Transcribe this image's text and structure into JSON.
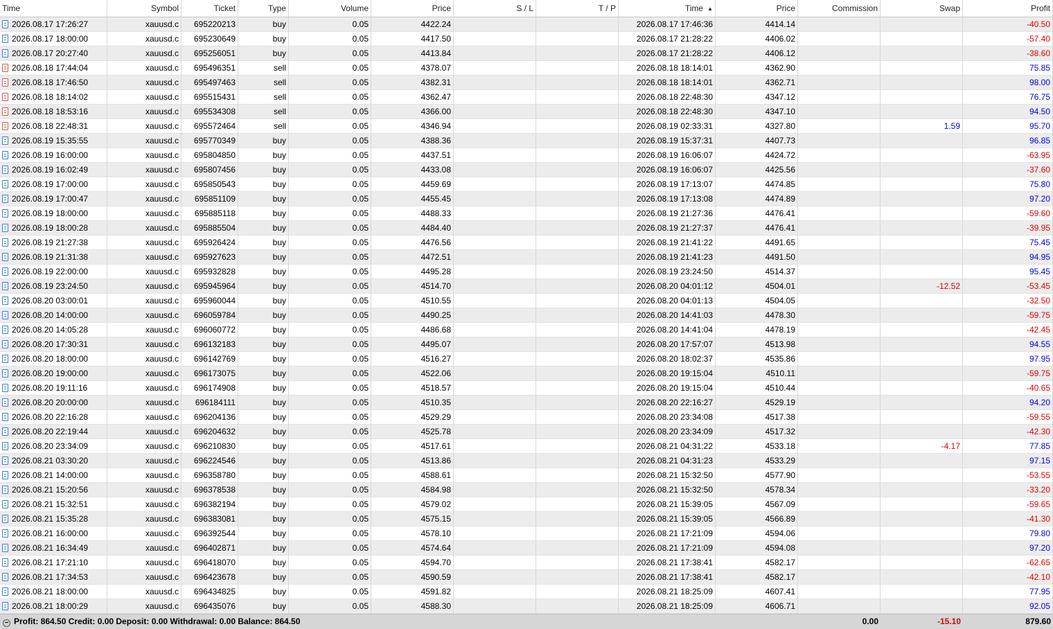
{
  "columns": [
    {
      "key": "open_time",
      "label": "Time",
      "align": "l"
    },
    {
      "key": "symbol",
      "label": "Symbol",
      "align": "r"
    },
    {
      "key": "ticket",
      "label": "Ticket",
      "align": "r"
    },
    {
      "key": "type",
      "label": "Type",
      "align": "r"
    },
    {
      "key": "volume",
      "label": "Volume",
      "align": "r"
    },
    {
      "key": "open_price",
      "label": "Price",
      "align": "r"
    },
    {
      "key": "sl",
      "label": "S / L",
      "align": "r"
    },
    {
      "key": "tp",
      "label": "T / P",
      "align": "r"
    },
    {
      "key": "close_time",
      "label": "Time",
      "align": "r",
      "sort": "▲"
    },
    {
      "key": "close_price",
      "label": "Price",
      "align": "r"
    },
    {
      "key": "commission",
      "label": "Commission",
      "align": "r"
    },
    {
      "key": "swap",
      "label": "Swap",
      "align": "r"
    },
    {
      "key": "profit",
      "label": "Profit",
      "align": "r"
    }
  ],
  "rows": [
    {
      "open_time": "2026.08.17 17:26:27",
      "symbol": "xauusd.c",
      "ticket": "695220213",
      "type": "buy",
      "volume": "0.05",
      "open_price": "4422.24",
      "sl": "",
      "tp": "",
      "close_time": "2026.08.17 17:46:36",
      "close_price": "4414.14",
      "commission": "",
      "swap": "",
      "profit": "-40.50"
    },
    {
      "open_time": "2026.08.17 18:00:00",
      "symbol": "xauusd.c",
      "ticket": "695230649",
      "type": "buy",
      "volume": "0.05",
      "open_price": "4417.50",
      "sl": "",
      "tp": "",
      "close_time": "2026.08.17 21:28:22",
      "close_price": "4406.02",
      "commission": "",
      "swap": "",
      "profit": "-57.40"
    },
    {
      "open_time": "2026.08.17 20:27:40",
      "symbol": "xauusd.c",
      "ticket": "695256051",
      "type": "buy",
      "volume": "0.05",
      "open_price": "4413.84",
      "sl": "",
      "tp": "",
      "close_time": "2026.08.17 21:28:22",
      "close_price": "4406.12",
      "commission": "",
      "swap": "",
      "profit": "-38.60"
    },
    {
      "open_time": "2026.08.18 17:44:04",
      "symbol": "xauusd.c",
      "ticket": "695496351",
      "type": "sell",
      "volume": "0.05",
      "open_price": "4378.07",
      "sl": "",
      "tp": "",
      "close_time": "2026.08.18 18:14:01",
      "close_price": "4362.90",
      "commission": "",
      "swap": "",
      "profit": "75.85"
    },
    {
      "open_time": "2026.08.18 17:46:50",
      "symbol": "xauusd.c",
      "ticket": "695497463",
      "type": "sell",
      "volume": "0.05",
      "open_price": "4382.31",
      "sl": "",
      "tp": "",
      "close_time": "2026.08.18 18:14:01",
      "close_price": "4362.71",
      "commission": "",
      "swap": "",
      "profit": "98.00"
    },
    {
      "open_time": "2026.08.18 18:14:02",
      "symbol": "xauusd.c",
      "ticket": "695515431",
      "type": "sell",
      "volume": "0.05",
      "open_price": "4362.47",
      "sl": "",
      "tp": "",
      "close_time": "2026.08.18 22:48:30",
      "close_price": "4347.12",
      "commission": "",
      "swap": "",
      "profit": "76.75"
    },
    {
      "open_time": "2026.08.18 18:53:16",
      "symbol": "xauusd.c",
      "ticket": "695534308",
      "type": "sell",
      "volume": "0.05",
      "open_price": "4366.00",
      "sl": "",
      "tp": "",
      "close_time": "2026.08.18 22:48:30",
      "close_price": "4347.10",
      "commission": "",
      "swap": "",
      "profit": "94.50"
    },
    {
      "open_time": "2026.08.18 22:48:31",
      "symbol": "xauusd.c",
      "ticket": "695572464",
      "type": "sell",
      "volume": "0.05",
      "open_price": "4346.94",
      "sl": "",
      "tp": "",
      "close_time": "2026.08.19 02:33:31",
      "close_price": "4327.80",
      "commission": "",
      "swap": "1.59",
      "profit": "95.70"
    },
    {
      "open_time": "2026.08.19 15:35:55",
      "symbol": "xauusd.c",
      "ticket": "695770349",
      "type": "buy",
      "volume": "0.05",
      "open_price": "4388.36",
      "sl": "",
      "tp": "",
      "close_time": "2026.08.19 15:37:31",
      "close_price": "4407.73",
      "commission": "",
      "swap": "",
      "profit": "96.85"
    },
    {
      "open_time": "2026.08.19 16:00:00",
      "symbol": "xauusd.c",
      "ticket": "695804850",
      "type": "buy",
      "volume": "0.05",
      "open_price": "4437.51",
      "sl": "",
      "tp": "",
      "close_time": "2026.08.19 16:06:07",
      "close_price": "4424.72",
      "commission": "",
      "swap": "",
      "profit": "-63.95"
    },
    {
      "open_time": "2026.08.19 16:02:49",
      "symbol": "xauusd.c",
      "ticket": "695807456",
      "type": "buy",
      "volume": "0.05",
      "open_price": "4433.08",
      "sl": "",
      "tp": "",
      "close_time": "2026.08.19 16:06:07",
      "close_price": "4425.56",
      "commission": "",
      "swap": "",
      "profit": "-37.60"
    },
    {
      "open_time": "2026.08.19 17:00:00",
      "symbol": "xauusd.c",
      "ticket": "695850543",
      "type": "buy",
      "volume": "0.05",
      "open_price": "4459.69",
      "sl": "",
      "tp": "",
      "close_time": "2026.08.19 17:13:07",
      "close_price": "4474.85",
      "commission": "",
      "swap": "",
      "profit": "75.80"
    },
    {
      "open_time": "2026.08.19 17:00:47",
      "symbol": "xauusd.c",
      "ticket": "695851109",
      "type": "buy",
      "volume": "0.05",
      "open_price": "4455.45",
      "sl": "",
      "tp": "",
      "close_time": "2026.08.19 17:13:08",
      "close_price": "4474.89",
      "commission": "",
      "swap": "",
      "profit": "97.20"
    },
    {
      "open_time": "2026.08.19 18:00:00",
      "symbol": "xauusd.c",
      "ticket": "695885118",
      "type": "buy",
      "volume": "0.05",
      "open_price": "4488.33",
      "sl": "",
      "tp": "",
      "close_time": "2026.08.19 21:27:36",
      "close_price": "4476.41",
      "commission": "",
      "swap": "",
      "profit": "-59.60"
    },
    {
      "open_time": "2026.08.19 18:00:28",
      "symbol": "xauusd.c",
      "ticket": "695885504",
      "type": "buy",
      "volume": "0.05",
      "open_price": "4484.40",
      "sl": "",
      "tp": "",
      "close_time": "2026.08.19 21:27:37",
      "close_price": "4476.41",
      "commission": "",
      "swap": "",
      "profit": "-39.95"
    },
    {
      "open_time": "2026.08.19 21:27:38",
      "symbol": "xauusd.c",
      "ticket": "695926424",
      "type": "buy",
      "volume": "0.05",
      "open_price": "4476.56",
      "sl": "",
      "tp": "",
      "close_time": "2026.08.19 21:41:22",
      "close_price": "4491.65",
      "commission": "",
      "swap": "",
      "profit": "75.45"
    },
    {
      "open_time": "2026.08.19 21:31:38",
      "symbol": "xauusd.c",
      "ticket": "695927623",
      "type": "buy",
      "volume": "0.05",
      "open_price": "4472.51",
      "sl": "",
      "tp": "",
      "close_time": "2026.08.19 21:41:23",
      "close_price": "4491.50",
      "commission": "",
      "swap": "",
      "profit": "94.95"
    },
    {
      "open_time": "2026.08.19 22:00:00",
      "symbol": "xauusd.c",
      "ticket": "695932828",
      "type": "buy",
      "volume": "0.05",
      "open_price": "4495.28",
      "sl": "",
      "tp": "",
      "close_time": "2026.08.19 23:24:50",
      "close_price": "4514.37",
      "commission": "",
      "swap": "",
      "profit": "95.45"
    },
    {
      "open_time": "2026.08.19 23:24:50",
      "symbol": "xauusd.c",
      "ticket": "695945964",
      "type": "buy",
      "volume": "0.05",
      "open_price": "4514.70",
      "sl": "",
      "tp": "",
      "close_time": "2026.08.20 04:01:12",
      "close_price": "4504.01",
      "commission": "",
      "swap": "-12.52",
      "profit": "-53.45"
    },
    {
      "open_time": "2026.08.20 03:00:01",
      "symbol": "xauusd.c",
      "ticket": "695960044",
      "type": "buy",
      "volume": "0.05",
      "open_price": "4510.55",
      "sl": "",
      "tp": "",
      "close_time": "2026.08.20 04:01:13",
      "close_price": "4504.05",
      "commission": "",
      "swap": "",
      "profit": "-32.50"
    },
    {
      "open_time": "2026.08.20 14:00:00",
      "symbol": "xauusd.c",
      "ticket": "696059784",
      "type": "buy",
      "volume": "0.05",
      "open_price": "4490.25",
      "sl": "",
      "tp": "",
      "close_time": "2026.08.20 14:41:03",
      "close_price": "4478.30",
      "commission": "",
      "swap": "",
      "profit": "-59.75"
    },
    {
      "open_time": "2026.08.20 14:05:28",
      "symbol": "xauusd.c",
      "ticket": "696060772",
      "type": "buy",
      "volume": "0.05",
      "open_price": "4486.68",
      "sl": "",
      "tp": "",
      "close_time": "2026.08.20 14:41:04",
      "close_price": "4478.19",
      "commission": "",
      "swap": "",
      "profit": "-42.45"
    },
    {
      "open_time": "2026.08.20 17:30:31",
      "symbol": "xauusd.c",
      "ticket": "696132183",
      "type": "buy",
      "volume": "0.05",
      "open_price": "4495.07",
      "sl": "",
      "tp": "",
      "close_time": "2026.08.20 17:57:07",
      "close_price": "4513.98",
      "commission": "",
      "swap": "",
      "profit": "94.55"
    },
    {
      "open_time": "2026.08.20 18:00:00",
      "symbol": "xauusd.c",
      "ticket": "696142769",
      "type": "buy",
      "volume": "0.05",
      "open_price": "4516.27",
      "sl": "",
      "tp": "",
      "close_time": "2026.08.20 18:02:37",
      "close_price": "4535.86",
      "commission": "",
      "swap": "",
      "profit": "97.95"
    },
    {
      "open_time": "2026.08.20 19:00:00",
      "symbol": "xauusd.c",
      "ticket": "696173075",
      "type": "buy",
      "volume": "0.05",
      "open_price": "4522.06",
      "sl": "",
      "tp": "",
      "close_time": "2026.08.20 19:15:04",
      "close_price": "4510.11",
      "commission": "",
      "swap": "",
      "profit": "-59.75"
    },
    {
      "open_time": "2026.08.20 19:11:16",
      "symbol": "xauusd.c",
      "ticket": "696174908",
      "type": "buy",
      "volume": "0.05",
      "open_price": "4518.57",
      "sl": "",
      "tp": "",
      "close_time": "2026.08.20 19:15:04",
      "close_price": "4510.44",
      "commission": "",
      "swap": "",
      "profit": "-40.65"
    },
    {
      "open_time": "2026.08.20 20:00:00",
      "symbol": "xauusd.c",
      "ticket": "696184111",
      "type": "buy",
      "volume": "0.05",
      "open_price": "4510.35",
      "sl": "",
      "tp": "",
      "close_time": "2026.08.20 22:16:27",
      "close_price": "4529.19",
      "commission": "",
      "swap": "",
      "profit": "94.20"
    },
    {
      "open_time": "2026.08.20 22:16:28",
      "symbol": "xauusd.c",
      "ticket": "696204136",
      "type": "buy",
      "volume": "0.05",
      "open_price": "4529.29",
      "sl": "",
      "tp": "",
      "close_time": "2026.08.20 23:34:08",
      "close_price": "4517.38",
      "commission": "",
      "swap": "",
      "profit": "-59.55"
    },
    {
      "open_time": "2026.08.20 22:19:44",
      "symbol": "xauusd.c",
      "ticket": "696204632",
      "type": "buy",
      "volume": "0.05",
      "open_price": "4525.78",
      "sl": "",
      "tp": "",
      "close_time": "2026.08.20 23:34:09",
      "close_price": "4517.32",
      "commission": "",
      "swap": "",
      "profit": "-42.30"
    },
    {
      "open_time": "2026.08.20 23:34:09",
      "symbol": "xauusd.c",
      "ticket": "696210830",
      "type": "buy",
      "volume": "0.05",
      "open_price": "4517.61",
      "sl": "",
      "tp": "",
      "close_time": "2026.08.21 04:31:22",
      "close_price": "4533.18",
      "commission": "",
      "swap": "-4.17",
      "profit": "77.85"
    },
    {
      "open_time": "2026.08.21 03:30:20",
      "symbol": "xauusd.c",
      "ticket": "696224546",
      "type": "buy",
      "volume": "0.05",
      "open_price": "4513.86",
      "sl": "",
      "tp": "",
      "close_time": "2026.08.21 04:31:23",
      "close_price": "4533.29",
      "commission": "",
      "swap": "",
      "profit": "97.15"
    },
    {
      "open_time": "2026.08.21 14:00:00",
      "symbol": "xauusd.c",
      "ticket": "696358780",
      "type": "buy",
      "volume": "0.05",
      "open_price": "4588.61",
      "sl": "",
      "tp": "",
      "close_time": "2026.08.21 15:32:50",
      "close_price": "4577.90",
      "commission": "",
      "swap": "",
      "profit": "-53.55"
    },
    {
      "open_time": "2026.08.21 15:20:56",
      "symbol": "xauusd.c",
      "ticket": "696378538",
      "type": "buy",
      "volume": "0.05",
      "open_price": "4584.98",
      "sl": "",
      "tp": "",
      "close_time": "2026.08.21 15:32:50",
      "close_price": "4578.34",
      "commission": "",
      "swap": "",
      "profit": "-33.20"
    },
    {
      "open_time": "2026.08.21 15:32:51",
      "symbol": "xauusd.c",
      "ticket": "696382194",
      "type": "buy",
      "volume": "0.05",
      "open_price": "4579.02",
      "sl": "",
      "tp": "",
      "close_time": "2026.08.21 15:39:05",
      "close_price": "4567.09",
      "commission": "",
      "swap": "",
      "profit": "-59.65"
    },
    {
      "open_time": "2026.08.21 15:35:28",
      "symbol": "xauusd.c",
      "ticket": "696383081",
      "type": "buy",
      "volume": "0.05",
      "open_price": "4575.15",
      "sl": "",
      "tp": "",
      "close_time": "2026.08.21 15:39:05",
      "close_price": "4566.89",
      "commission": "",
      "swap": "",
      "profit": "-41.30"
    },
    {
      "open_time": "2026.08.21 16:00:00",
      "symbol": "xauusd.c",
      "ticket": "696392544",
      "type": "buy",
      "volume": "0.05",
      "open_price": "4578.10",
      "sl": "",
      "tp": "",
      "close_time": "2026.08.21 17:21:09",
      "close_price": "4594.06",
      "commission": "",
      "swap": "",
      "profit": "79.80"
    },
    {
      "open_time": "2026.08.21 16:34:49",
      "symbol": "xauusd.c",
      "ticket": "696402871",
      "type": "buy",
      "volume": "0.05",
      "open_price": "4574.64",
      "sl": "",
      "tp": "",
      "close_time": "2026.08.21 17:21:09",
      "close_price": "4594.08",
      "commission": "",
      "swap": "",
      "profit": "97.20"
    },
    {
      "open_time": "2026.08.21 17:21:10",
      "symbol": "xauusd.c",
      "ticket": "696418070",
      "type": "buy",
      "volume": "0.05",
      "open_price": "4594.70",
      "sl": "",
      "tp": "",
      "close_time": "2026.08.21 17:38:41",
      "close_price": "4582.17",
      "commission": "",
      "swap": "",
      "profit": "-62.65"
    },
    {
      "open_time": "2026.08.21 17:34:53",
      "symbol": "xauusd.c",
      "ticket": "696423678",
      "type": "buy",
      "volume": "0.05",
      "open_price": "4590.59",
      "sl": "",
      "tp": "",
      "close_time": "2026.08.21 17:38:41",
      "close_price": "4582.17",
      "commission": "",
      "swap": "",
      "profit": "-42.10"
    },
    {
      "open_time": "2026.08.21 18:00:00",
      "symbol": "xauusd.c",
      "ticket": "696434825",
      "type": "buy",
      "volume": "0.05",
      "open_price": "4591.82",
      "sl": "",
      "tp": "",
      "close_time": "2026.08.21 18:25:09",
      "close_price": "4607.41",
      "commission": "",
      "swap": "",
      "profit": "77.95"
    },
    {
      "open_time": "2026.08.21 18:00:29",
      "symbol": "xauusd.c",
      "ticket": "696435076",
      "type": "buy",
      "volume": "0.05",
      "open_price": "4588.30",
      "sl": "",
      "tp": "",
      "close_time": "2026.08.21 18:25:09",
      "close_price": "4606.71",
      "commission": "",
      "swap": "",
      "profit": "92.05"
    }
  ],
  "footer": {
    "summary": "Profit: 864.50  Credit: 0.00  Deposit: 0.00  Withdrawal: 0.00  Balance: 864.50",
    "commission_total": "0.00",
    "swap_total": "-15.10",
    "profit_total": "879.60"
  },
  "colors": {
    "negative": "#e00000",
    "positive": "#0000e0",
    "buy_icon": "#3a7bd5",
    "sell_icon": "#d9534f"
  }
}
